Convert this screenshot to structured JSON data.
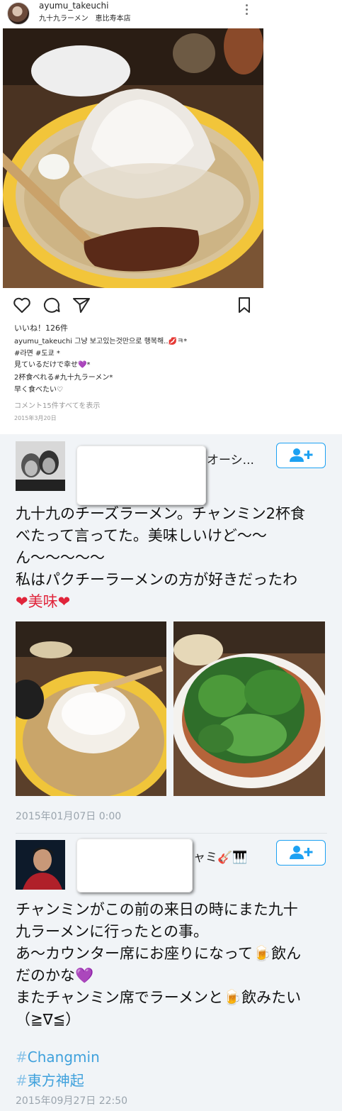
{
  "instagram": {
    "username": "ayumu_takeuchi",
    "location": "九十九ラーメン　恵比寿本店",
    "likes": "いいね！126件",
    "caption_lines": [
      "ayumu_takeuchi 그냥 보고있는것만으로 행복해..💋ㅋ*",
      "#라면 #도쿄 *",
      "見ているだけで幸せ💜*",
      "2杯食べれる#九十九ラーメン*",
      "早く食べたい♡"
    ],
    "view_comments": "コメント15件すべてを表示",
    "date": "2015年3月20日",
    "icons": [
      "heart-icon",
      "comment-icon",
      "share-icon",
      "bookmark-icon",
      "more-icon"
    ]
  },
  "tweets": [
    {
      "name_visible": "オーシ...",
      "text_lines": [
        "九十九のチーズラーメン。チャンミン2杯食",
        "べたって言ってた。美味しいけど～～",
        "ん～～～～～",
        "私はパクチーラーメンの方が好きだったわ",
        "❤美味❤"
      ],
      "timestamp": "2015年01月07日 0:00"
    },
    {
      "name_visible": "ャミ🎸🎹",
      "text_lines": [
        "チャンミンがこの前の来日の時にまた九十",
        "九ラーメンに行ったとの事。",
        "あ～カウンター席にお座りになって🍺飲ん",
        "だのかな💜",
        "またチャンミン席でラーメンと🍺飲みたい",
        "（≧∇≦）"
      ],
      "hashtags": [
        {
          "hash": "#",
          "tag": "Changmin"
        },
        {
          "hash": "#",
          "tag": "東方神起"
        }
      ],
      "timestamp": "2015年09月27日 22:50"
    }
  ],
  "colors": {
    "twitter_blue": "#1da1f2",
    "hashtag": "#3fa1dc",
    "meta_gray": "#9aa4ad",
    "tw_background": "#f1f4f7"
  }
}
